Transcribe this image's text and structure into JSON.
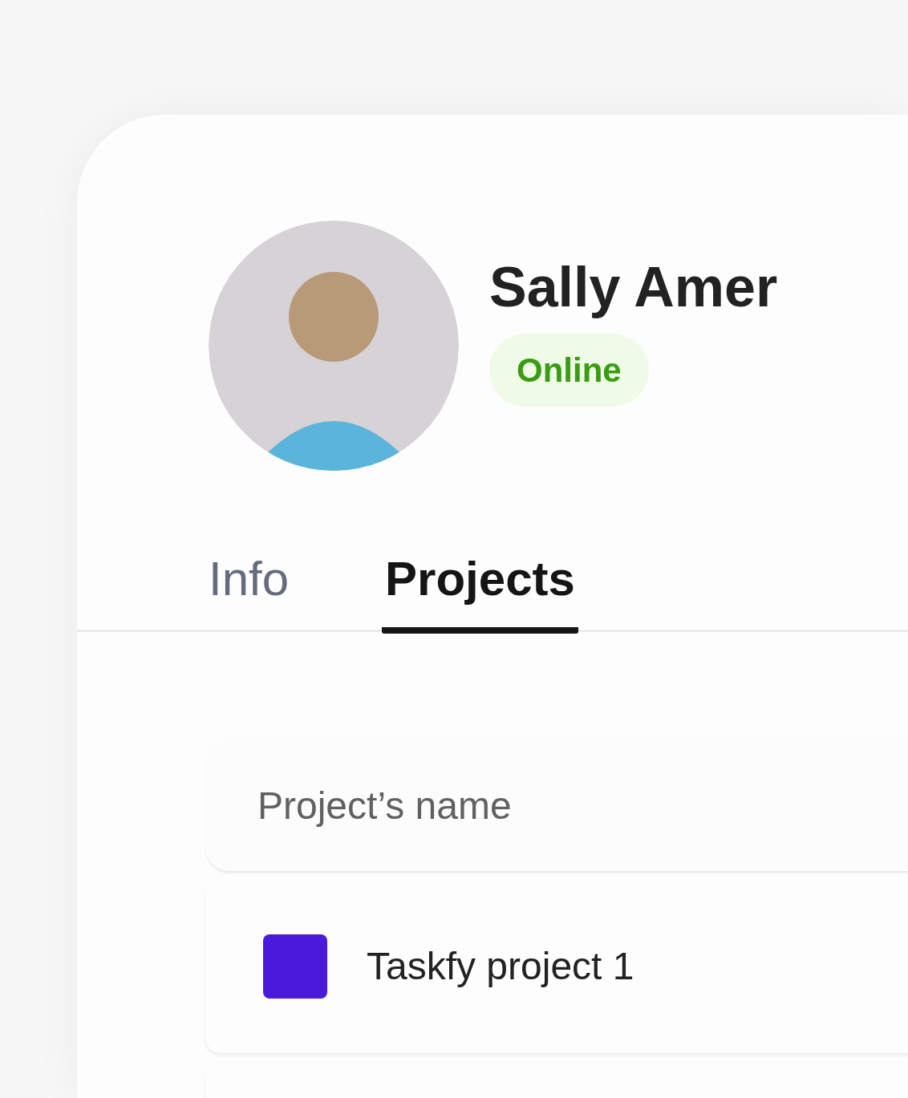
{
  "profile": {
    "name": "Sally Amer",
    "status": {
      "label": "Online",
      "kind": "online"
    }
  },
  "tabs": [
    {
      "label": "Info",
      "selected": false
    },
    {
      "label": "Projects",
      "selected": true
    }
  ],
  "table": {
    "columns": [
      "Project’s name"
    ],
    "rows": [
      {
        "name": "Taskfy project 1",
        "color": "#4a19dc"
      }
    ]
  }
}
